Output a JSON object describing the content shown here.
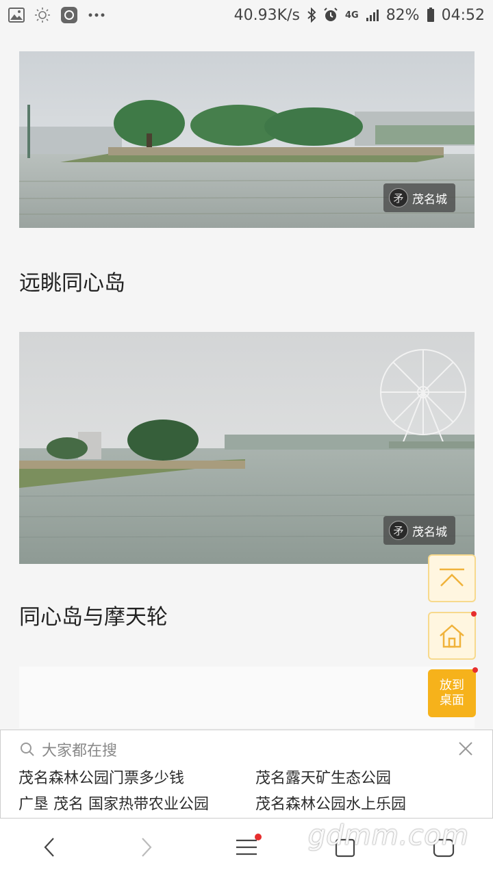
{
  "status_bar": {
    "net_speed": "40.93K/s",
    "network": "4G",
    "battery": "82%",
    "time": "04:52"
  },
  "photos": [
    {
      "watermark": "茂名城",
      "logo_letter": "矛",
      "caption": "远眺同心岛"
    },
    {
      "watermark": "茂名城",
      "logo_letter": "矛",
      "caption": "同心岛与摩天轮"
    }
  ],
  "fabs": {
    "desktop_line1": "放到",
    "desktop_line2": "桌面"
  },
  "search_panel": {
    "header": "大家都在搜",
    "items": [
      "茂名森林公园门票多少钱",
      "茂名露天矿生态公园",
      "广垦 茂名 国家热带农业公园",
      "茂名森林公园水上乐园"
    ]
  },
  "site_watermark": "gdmm.com",
  "colors": {
    "accent": "#f6b21b",
    "fab_outline_bg": "#fff6e0",
    "badge_red": "#e62e2e"
  }
}
